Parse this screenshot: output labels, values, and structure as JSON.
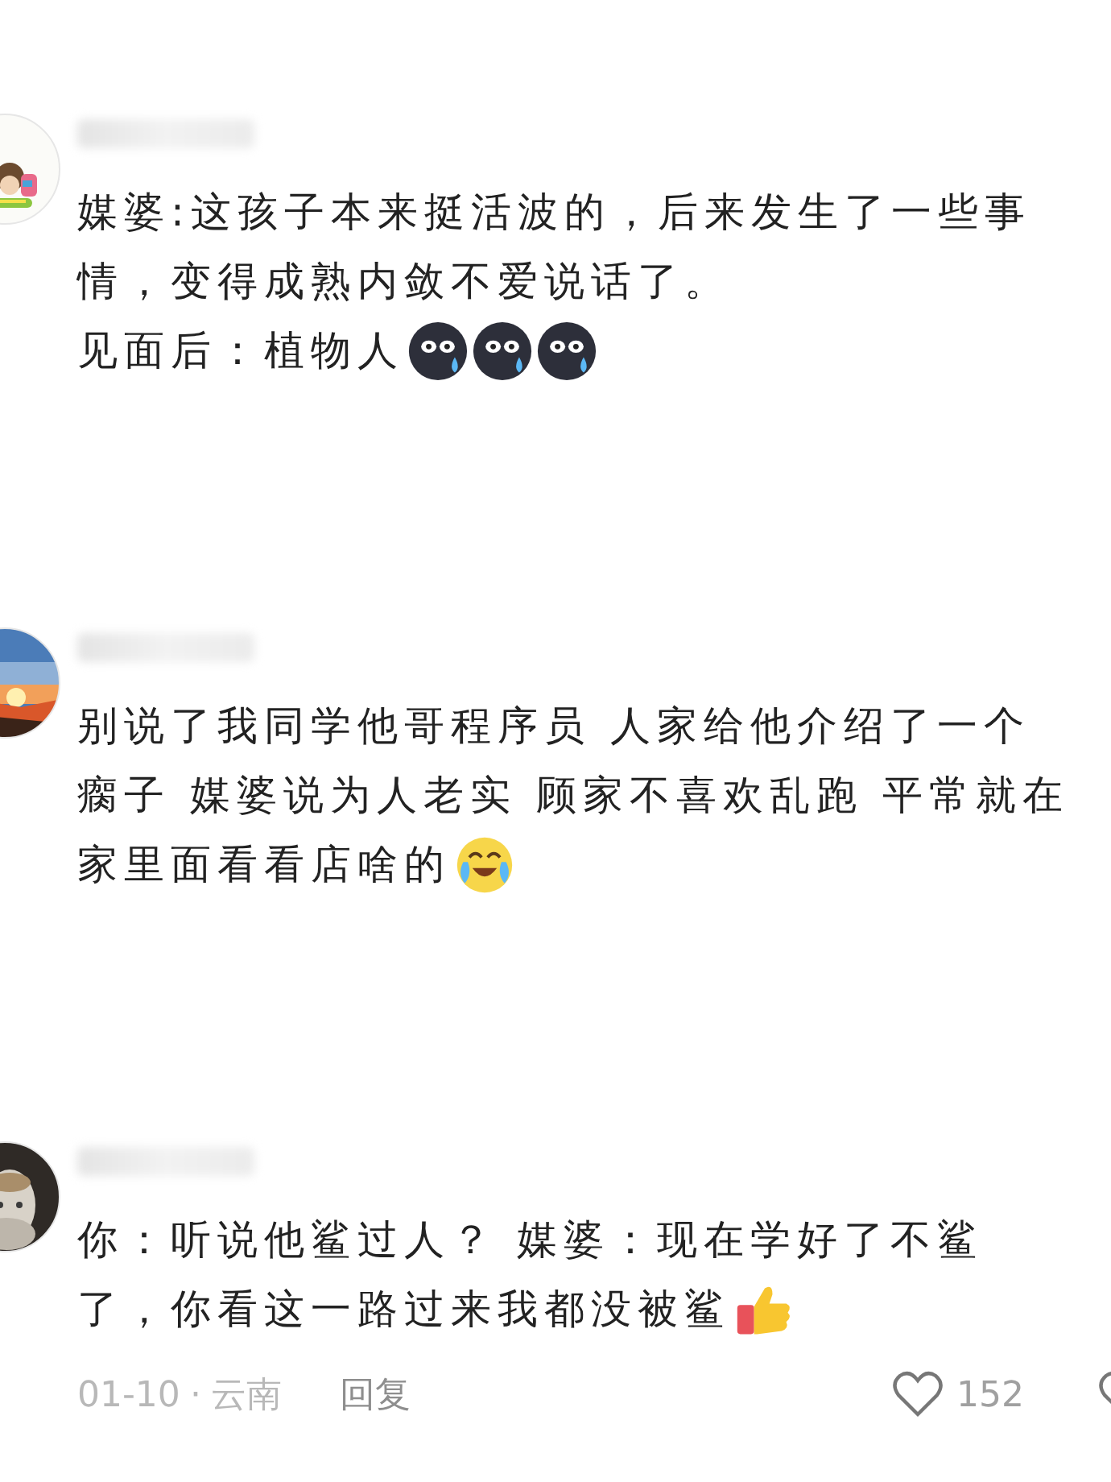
{
  "comments": [
    {
      "avatar": {
        "kind": "picture"
      },
      "paragraphs": [
        {
          "lines": [
            "媒婆:这孩子本来挺活波的，后来发生了一些事",
            "情，变得成熟内敛不爱说话了。"
          ]
        },
        {
          "lines": [
            "见面后：植物人"
          ],
          "emojis": [
            {
              "kind": "sweat-blob"
            },
            {
              "kind": "sweat-blob"
            },
            {
              "kind": "sweat-blob"
            }
          ]
        }
      ]
    },
    {
      "avatar": {
        "kind": "picture"
      },
      "paragraphs": [
        {
          "lines": [
            "别说了我同学他哥程序员 人家给他介绍了一个",
            "瘸子 媒婆说为人老实 顾家不喜欢乱跑 平常就在",
            "家里面看看店啥的"
          ],
          "emojis": [
            {
              "kind": "crying-laugh"
            }
          ]
        }
      ]
    },
    {
      "avatar": {
        "kind": "picture"
      },
      "paragraphs": [
        {
          "lines": [
            "你：听说他鲨过人？ 媒婆：现在学好了不鲨",
            "了，你看这一路过来我都没被鲨"
          ],
          "emojis": [
            {
              "kind": "thumbs-up"
            }
          ]
        }
      ],
      "meta": {
        "date": "01-10",
        "separator": "·",
        "location": "云南",
        "reply": "回复",
        "likes": "152"
      }
    }
  ]
}
